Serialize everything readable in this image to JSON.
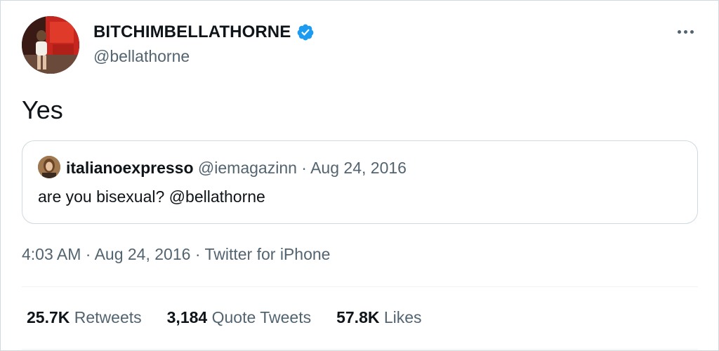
{
  "author": {
    "display_name": "BITCHIMBELLATHORNE",
    "handle": "@bellathorne",
    "verified": true
  },
  "tweet": {
    "text": "Yes"
  },
  "quoted_tweet": {
    "display_name": "italianoexpresso",
    "handle": "@iemagazinn",
    "separator": "·",
    "date": "Aug 24, 2016",
    "text": "are you bisexual? @bellathorne"
  },
  "meta": {
    "time": "4:03 AM",
    "separator": "·",
    "date": "Aug 24, 2016",
    "source": "Twitter for iPhone"
  },
  "stats": [
    {
      "value": "25.7K",
      "label": "Retweets"
    },
    {
      "value": "3,184",
      "label": "Quote Tweets"
    },
    {
      "value": "57.8K",
      "label": "Likes"
    }
  ],
  "colors": {
    "verified_blue": "#1d9bf0",
    "secondary_text": "#536471",
    "border": "#cfd9de"
  },
  "icons": {
    "verified": "verified-badge-icon",
    "more": "more-options-icon"
  }
}
